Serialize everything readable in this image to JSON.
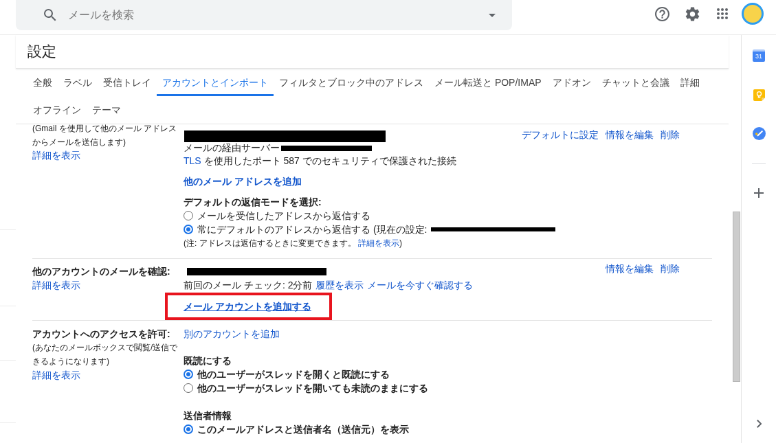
{
  "search": {
    "placeholder": "メールを検索"
  },
  "settings": {
    "title": "設定"
  },
  "tabs": [
    {
      "label": "全般",
      "selected": false
    },
    {
      "label": "ラベル",
      "selected": false
    },
    {
      "label": "受信トレイ",
      "selected": false
    },
    {
      "label": "アカウントとインポート",
      "selected": true
    },
    {
      "label": "フィルタとブロック中のアドレス",
      "selected": false
    },
    {
      "label": "メール転送と POP/IMAP",
      "selected": false
    },
    {
      "label": "アドオン",
      "selected": false
    },
    {
      "label": "チャットと会議",
      "selected": false
    },
    {
      "label": "詳細",
      "selected": false
    },
    {
      "label": "オフライン",
      "selected": false
    },
    {
      "label": "テーマ",
      "selected": false
    }
  ],
  "send_mail_as": {
    "note": [
      "(Gmail を使用して他のメール アドレス",
      "からメールを送信します)"
    ],
    "details_link": "詳細を表示",
    "account": {
      "name_redacted": true,
      "server_label": "メールの経由サーバー",
      "server_redacted": true,
      "security_link": "TLS",
      "security_text": " を使用したポート 587 でのセキュリティで保護された接続",
      "actions": [
        "デフォルトに設定",
        "情報を編集",
        "削除"
      ]
    },
    "add_link": "他のメール アドレスを追加",
    "reply_mode": {
      "heading": "デフォルトの返信モードを選択:",
      "options": [
        {
          "label": "メールを受信したアドレスから返信する",
          "selected": false,
          "redacted": false
        },
        {
          "label": "常にデフォルトのアドレスから返信する (現在の設定:",
          "selected": true,
          "redacted": true
        }
      ],
      "note": "(注: アドレスは返信するときに変更できます。",
      "note_link": "詳細を表示",
      "note_end": ")"
    }
  },
  "check_mail": {
    "title": "他のアカウントのメールを確認:",
    "details_link": "詳細を表示",
    "account": {
      "name_redacted": true,
      "last_check": "前回のメール チェック: 2分前",
      "links": [
        "履歴を表示",
        "メールを今すぐ確認する"
      ],
      "actions": [
        "情報を編集",
        "削除"
      ]
    },
    "add_account": {
      "label": "メール アカウントを追加する",
      "highlighted": true
    }
  },
  "grant_access": {
    "title": "アカウントへのアクセスを許可:",
    "note": [
      "(あなたのメールボックスで閲覧/送信で",
      "きるようになります)"
    ],
    "details_link": "詳細を表示",
    "add_link": "別のアカウントを追加",
    "groups": [
      {
        "heading": "既読にする",
        "options": [
          {
            "label": "他のユーザーがスレッドを開くと既読にする",
            "selected": true
          },
          {
            "label": "他のユーザーがスレッドを開いても未読のままにする",
            "selected": false
          }
        ]
      },
      {
        "heading": "送信者情報",
        "options": [
          {
            "label": "このメールアドレスと送信者名（送信元）を表示",
            "selected": true
          }
        ]
      }
    ]
  },
  "side_panel": {
    "calendar_date": "31"
  }
}
